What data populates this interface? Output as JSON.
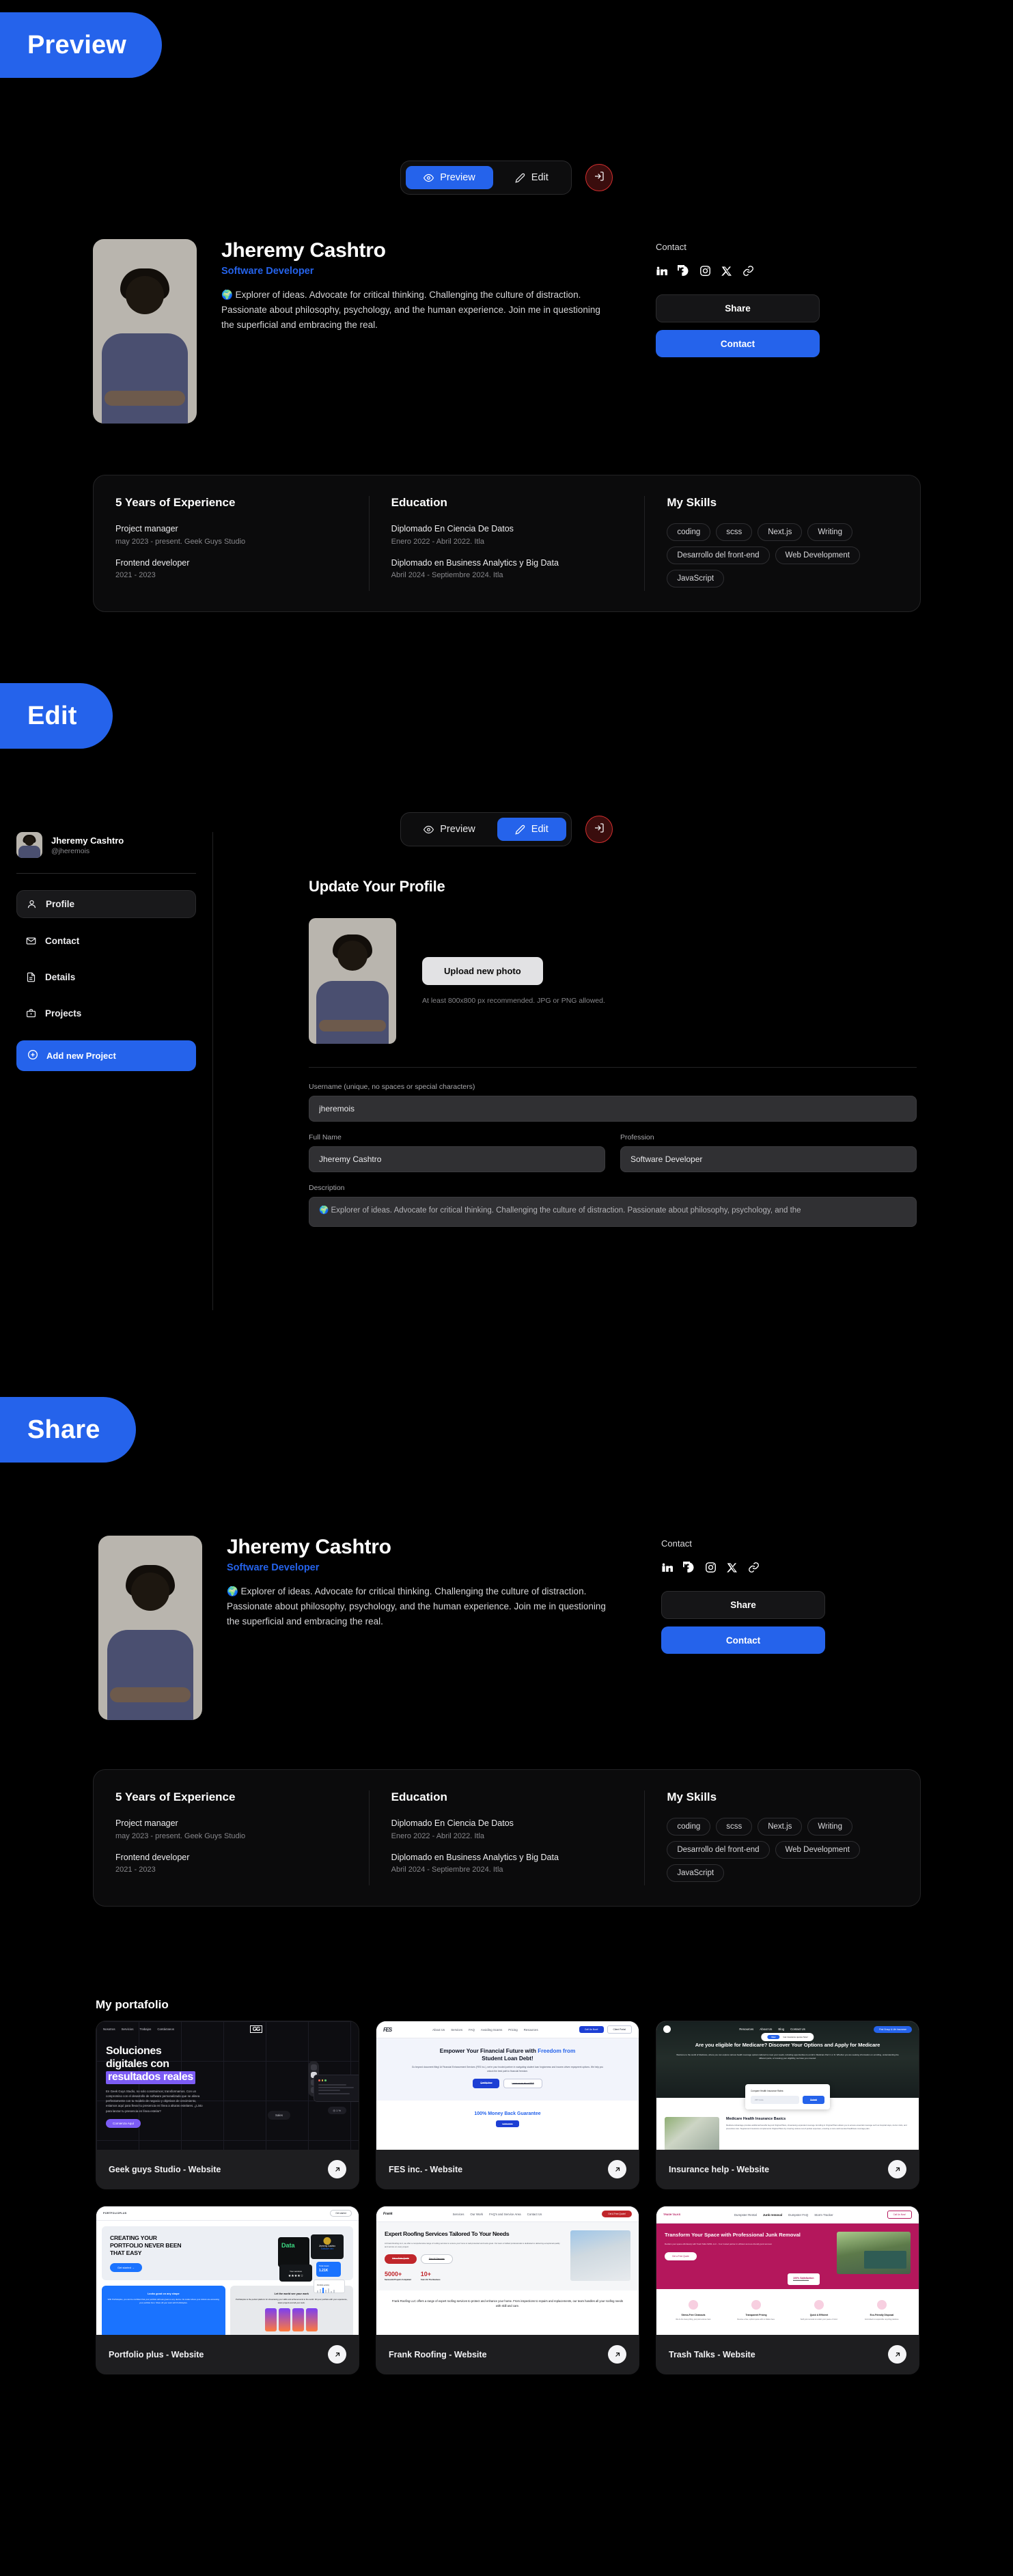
{
  "sections": {
    "preview_label": "Preview",
    "edit_label": "Edit",
    "share_label": "Share"
  },
  "toolbar": {
    "preview_label": "Preview",
    "edit_label": "Edit",
    "logout_name": "logout-icon",
    "accent_color": "#2563eb",
    "logout_color": "#d32f2f"
  },
  "profile": {
    "name": "Jheremy Cashtro",
    "role": "Software Developer",
    "bio": "🌍 Explorer of ideas. Advocate for critical thinking. Challenging the culture of distraction. Passionate about philosophy, psychology, and the human experience. Join me in questioning the superficial and embracing the real.",
    "handle": "@jheremois",
    "contact_title": "Contact",
    "share_button": "Share",
    "contact_button": "Contact",
    "socials": [
      "linkedin-icon",
      "facebook-icon",
      "instagram-icon",
      "x-icon",
      "link-icon"
    ]
  },
  "experience": {
    "heading": "5 Years of Experience",
    "items": [
      {
        "title": "Project manager",
        "meta": "may 2023 - present. Geek Guys Studio"
      },
      {
        "title": "Frontend developer",
        "meta": "2021 - 2023"
      }
    ]
  },
  "education": {
    "heading": "Education",
    "items": [
      {
        "title": "Diplomado En Ciencia De Datos",
        "meta": "Enero 2022 - Abril 2022. Itla"
      },
      {
        "title": "Diplomado en Business Analytics y Big Data",
        "meta": "Abril 2024 - Septiembre 2024. Itla"
      }
    ]
  },
  "skills": {
    "heading": "My Skills",
    "items": [
      "coding",
      "scss",
      "Next.js",
      "Writing",
      "Desarrollo del front-end",
      "Web Development",
      "JavaScript"
    ]
  },
  "sidebar": {
    "name": "Jheremy Cashtro",
    "handle": "@jheremois",
    "items": [
      {
        "label": "Profile",
        "icon": "user-icon",
        "active": true
      },
      {
        "label": "Contact",
        "icon": "mail-icon",
        "active": false
      },
      {
        "label": "Details",
        "icon": "document-icon",
        "active": false
      },
      {
        "label": "Projects",
        "icon": "briefcase-icon",
        "active": false
      }
    ],
    "add_project": "Add new Project"
  },
  "edit_form": {
    "title": "Update Your Profile",
    "upload_button": "Upload new photo",
    "upload_hint": "At least 800x800 px recommended. JPG or PNG allowed.",
    "username_label": "Username (unique, no spaces or special characters)",
    "username_value": "jheremois",
    "fullname_label": "Full Name",
    "fullname_value": "Jheremy Cashtro",
    "profession_label": "Profession",
    "profession_value": "Software Developer",
    "description_label": "Description",
    "description_value": "🌍 Explorer of ideas. Advocate for critical thinking. Challenging the culture of distraction. Passionate about philosophy, psychology, and the"
  },
  "portfolio": {
    "heading": "My portafolio",
    "projects": [
      {
        "name": "Geek guys Studio - Website",
        "mock": "geekguys"
      },
      {
        "name": "FES inc. - Website",
        "mock": "fes"
      },
      {
        "name": "Insurance help - Website",
        "mock": "insurance"
      },
      {
        "name": "Portfolio plus - Website",
        "mock": "portfolioplus"
      },
      {
        "name": "Frank Roofing - Website",
        "mock": "frank"
      },
      {
        "name": "Trash Talks - Website",
        "mock": "trash"
      }
    ]
  },
  "mockups": {
    "geekguys": {
      "nav": [
        "Nosotros",
        "Servicios",
        "Trabajos",
        "Contáctanos"
      ],
      "logo": "GG",
      "h1_a": "Soluciones",
      "h1_b": "digitales con",
      "h1_c": "resultados reales",
      "body": "En Geek Guys Studio, no solo construimos; transformamos. Con un compromiso con el desarrollo de software personalizado que se alinea perfectamente con tu modelo de negocio y objetivos de crecimiento, estamos aquí para llevar tu presencia en línea a alturas estelares. ¿Listo para lanzar tu presencia en línea estelar?",
      "cta": "Comienza Aquí",
      "sales": "Sales"
    },
    "fes": {
      "logo": "FES",
      "nav": [
        "About Us",
        "Services",
        "FAQ",
        "Avoiding Scams",
        "Pricing",
        "Resources"
      ],
      "cta1": "Call Us Now!",
      "cta2": "Client Portal",
      "h1_a": "Empower Your Financial Future with ",
      "h1_b": "Freedom from",
      "h1_c": "Student Loan Debt!",
      "body": "Go beyond document filing! At Financial Enhancement Services (FES Inc.), we're your trusted partner in navigating student loan forgiveness and income-driven repayment options. We help you unlock the best path to financial freedom.",
      "btn1": "Qualify Now",
      "btn2": "Learn more about FES",
      "guarantee": "100% Money Back Guarantee",
      "guarantee_btn": "Learn more"
    },
    "insurance": {
      "nav": [
        "Resources",
        "About Us",
        "Blog",
        "Contact Us"
      ],
      "cta": "Find Group & Life Insurance",
      "badge": "Get insurance quotes Now!",
      "badge_tag": "New",
      "h1": "Are you eligible for Medicare? Discover Your Options and Apply for Medicare",
      "body": "Welcome to the world of Medicare, where you can explore various health coverage options tailored to meet your needs, including opportunities to enroll in Medicare Part C or D. Whether you are seeking information on enrolling, understanding the different parts, or knowing your eligibility, we have you covered.",
      "form_label": "Compare Health Insurance Rates:",
      "form_placeholder": "ZIP Code",
      "form_submit": "Submit",
      "section_title": "Medicare Health Insurance Basics",
      "section_body": "Medicare Advantage provides additional benefits beyond Original Plans, showcasing expanded coverage. Enrolling in Original Plans allows you to access essential coverage such as hospital stays, doctor visits, and preventive care. Supplement insurance complements Original Plans by covering various out-of-pocket expenses, ensuring a more well-rounded healthcare coverage plan."
    },
    "portfolioplus": {
      "logo": "PORTFOLIOPLUS",
      "cta_top": "Get started",
      "h1": "CREATING YOUR PORTFOLIO NEVER BEEN THAT EASY",
      "cta": "Get started →",
      "card_data": "Data",
      "card_name": "Jheremy Cashtro",
      "card_role": "Software dev",
      "views_label": "Total views",
      "views_value": "1.21K",
      "services": "Your services",
      "activity": "Portfolio activity",
      "left_title": "Looks good on any shape",
      "left_body": "With Portfolioplus, you can be confident that your portfolio will look great on any device. No matter where your visitors are accessing your portfolio from. Show off your work with Portfolioplus.",
      "right_title": "Let the world see your work",
      "right_body": "Portfolioplus is the perfect platform for showcasing your skills and achievements to the world. Fill your portfolio with your experience, latest projects and all your work."
    },
    "frank": {
      "logo": "Frank",
      "nav": [
        "Services",
        "Our Work",
        "FAQ's and Service Area",
        "Contact Us"
      ],
      "cta_top": "Get A Free Quote!",
      "h1": "Expert Roofing Services Tailored To Your Needs",
      "body": "At Frank Roofing LLC, we offer a comprehensive range of roofing services to ensure your home is well-protected and looks great. Our team of skilled professionals is dedicated to delivering exceptional quality and service on every project.",
      "btn1": "Get a Free Quote",
      "btn2": "See All Services",
      "stat1_value": "5000+",
      "stat1_label": "Successful Projects Completed",
      "stat2_value": "10+",
      "stat2_label": "Years On The Business",
      "paragraph": "Frank Roofing LLC offers a range of expert roofing services to protect and enhance your home. From inspections to repairs and replacements, our team handles all your roofing needs with skill and care."
    },
    "trash": {
      "logo": "TRASH TALKS",
      "nav": [
        "Dumpster Rental",
        "Junk removal",
        "Dumpster FAQ",
        "Storm Tracker"
      ],
      "cta_top": "Call Us Now!",
      "h1": "Transform Your Space with Professional Junk Removal",
      "body": "Reclaim your space effortlessly with Trash Talks SWFL LLC - Your trusted partner in efficient and eco-friendly junk removal.",
      "cta": "Get a Free Quote",
      "badge_title": "100% Satisfaction",
      "badge_sub": "Guaranteed Service",
      "features": [
        {
          "title": "Stress-Free Cleanouts",
          "body": "We do the heavy lifting, just point and we haul."
        },
        {
          "title": "Transparent Pricing",
          "body": "Receive a free, upfront quote with no hidden fees."
        },
        {
          "title": "Quick & Efficient",
          "body": "Swift junk removal to reclaim your peace of mind."
        },
        {
          "title": "Eco-Friendly Disposal",
          "body": "Committed to responsible recycling practices."
        }
      ]
    }
  }
}
